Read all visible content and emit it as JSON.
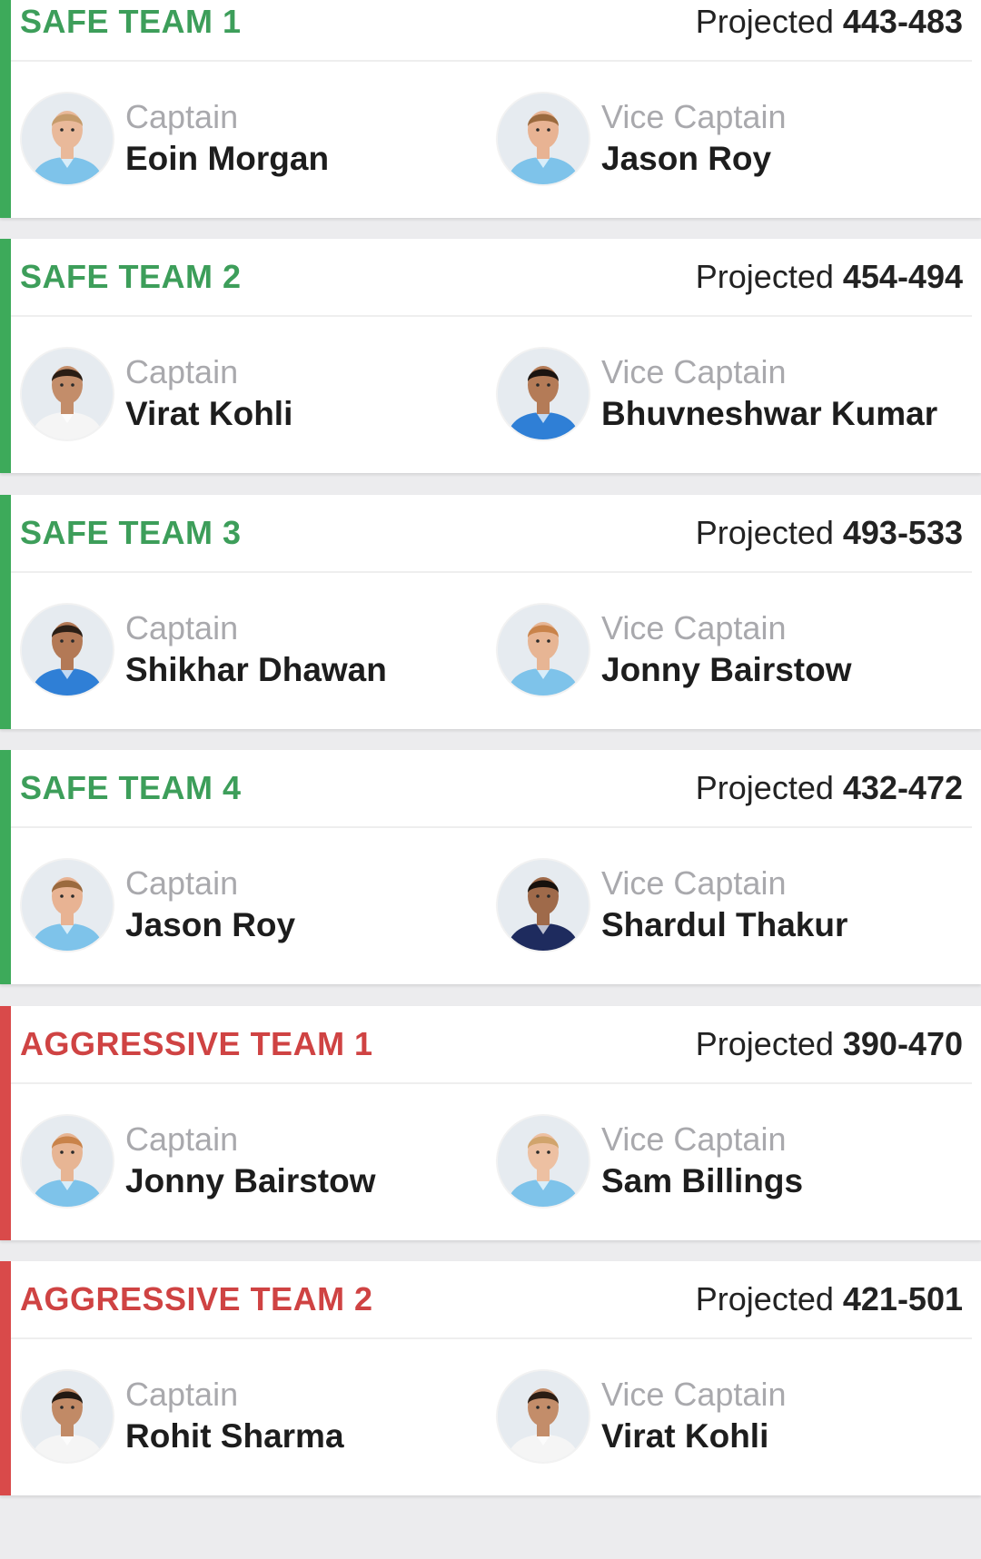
{
  "teams": [
    {
      "title": "SAFE TEAM 1",
      "type": "safe",
      "projected_label": "Projected",
      "projected_range": "443-483",
      "captain": {
        "role": "Captain",
        "name": "Eoin Morgan",
        "jersey": "#7ec3ea",
        "skin": "#e9b99a",
        "hair": "#c59b6b"
      },
      "vice_captain": {
        "role": "Vice Captain",
        "name": "Jason Roy",
        "jersey": "#7ec3ea",
        "skin": "#e8b393",
        "hair": "#9b6a3e"
      }
    },
    {
      "title": "SAFE TEAM 2",
      "type": "safe",
      "projected_label": "Projected",
      "projected_range": "454-494",
      "captain": {
        "role": "Captain",
        "name": "Virat Kohli",
        "jersey": "#f5f5f5",
        "skin": "#c38d6a",
        "hair": "#2a1d14"
      },
      "vice_captain": {
        "role": "Vice Captain",
        "name": "Bhuvneshwar Kumar",
        "jersey": "#2f7fd6",
        "skin": "#b47b57",
        "hair": "#1b1410"
      }
    },
    {
      "title": "SAFE TEAM 3",
      "type": "safe",
      "projected_label": "Projected",
      "projected_range": "493-533",
      "captain": {
        "role": "Captain",
        "name": "Shikhar Dhawan",
        "jersey": "#2f7fd6",
        "skin": "#b37956",
        "hair": "#2b1f16"
      },
      "vice_captain": {
        "role": "Vice Captain",
        "name": "Jonny Bairstow",
        "jersey": "#7ec3ea",
        "skin": "#e7b594",
        "hair": "#c9834a"
      }
    },
    {
      "title": "SAFE TEAM 4",
      "type": "safe",
      "projected_label": "Projected",
      "projected_range": "432-472",
      "captain": {
        "role": "Captain",
        "name": "Jason Roy",
        "jersey": "#7ec3ea",
        "skin": "#e8b393",
        "hair": "#9b6a3e"
      },
      "vice_captain": {
        "role": "Vice Captain",
        "name": "Shardul Thakur",
        "jersey": "#1e2b5e",
        "skin": "#9f6a4a",
        "hair": "#17110d"
      }
    },
    {
      "title": "AGGRESSIVE TEAM 1",
      "type": "aggressive",
      "projected_label": "Projected",
      "projected_range": "390-470",
      "captain": {
        "role": "Captain",
        "name": "Jonny Bairstow",
        "jersey": "#7ec3ea",
        "skin": "#e7b594",
        "hair": "#c9834a"
      },
      "vice_captain": {
        "role": "Vice Captain",
        "name": "Sam Billings",
        "jersey": "#7ec3ea",
        "skin": "#edc0a2",
        "hair": "#d1a46c"
      }
    },
    {
      "title": "AGGRESSIVE TEAM 2",
      "type": "aggressive",
      "projected_label": "Projected",
      "projected_range": "421-501",
      "captain": {
        "role": "Captain",
        "name": "Rohit Sharma",
        "jersey": "#f5f5f5",
        "skin": "#c18a66",
        "hair": "#221912"
      },
      "vice_captain": {
        "role": "Vice Captain",
        "name": "Virat Kohli",
        "jersey": "#f5f5f5",
        "skin": "#c38d6a",
        "hair": "#2a1d14"
      }
    }
  ],
  "colors": {
    "safe_accent": "#3d9e5a",
    "aggressive_accent": "#cf4343",
    "avatar_icon": "player-avatar-icon"
  }
}
